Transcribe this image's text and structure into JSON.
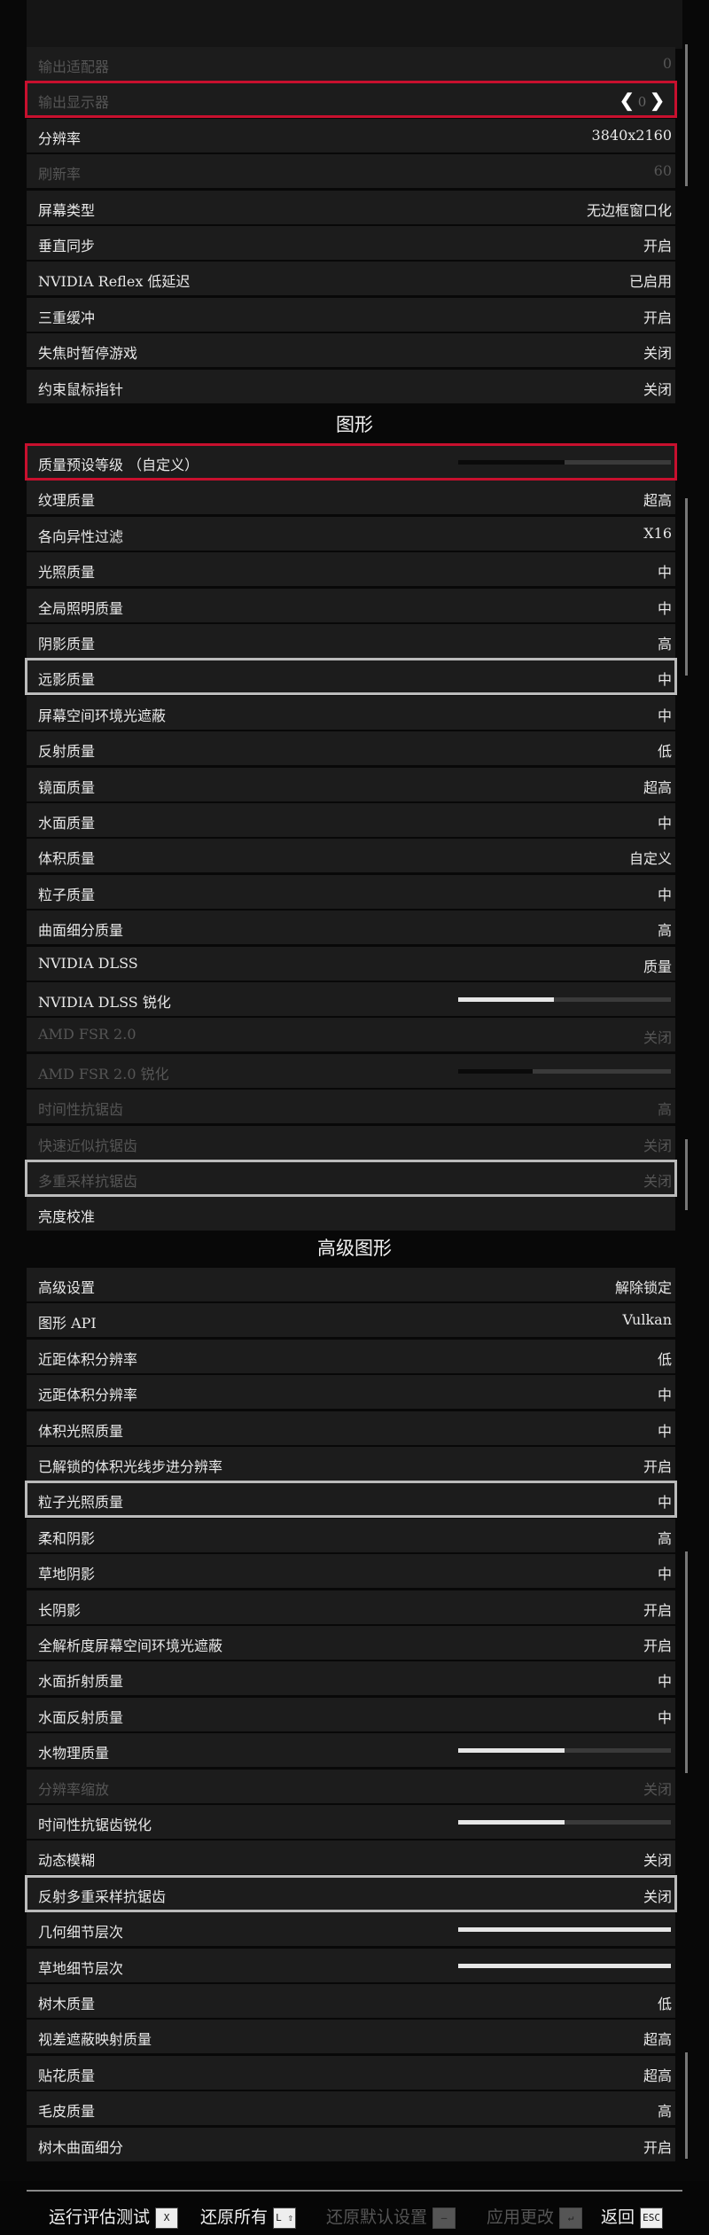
{
  "display_rows": [
    {
      "label": "输出适配器",
      "value": "0",
      "disabled": true
    },
    {
      "label": "输出显示器",
      "value": "0",
      "disabled": true,
      "arrows": true
    },
    {
      "label": "分辨率",
      "value": "3840x2160"
    },
    {
      "label": "刷新率",
      "value": "60",
      "disabled": true
    },
    {
      "label": "屏幕类型",
      "value": "无边框窗口化"
    },
    {
      "label": "垂直同步",
      "value": "开启"
    },
    {
      "label": "NVIDIA  Reflex  低延迟",
      "value": "已启用"
    },
    {
      "label": "三重缓冲",
      "value": "开启"
    },
    {
      "label": "失焦时暂停游戏",
      "value": "关闭"
    },
    {
      "label": "约束鼠标指针",
      "value": "关闭"
    }
  ],
  "graphics_title": "图形",
  "graphics_rows": [
    {
      "label": "质量预设等级  （自定义）",
      "value": "",
      "slider": 0.5,
      "slider_dark": true
    },
    {
      "label": "纹理质量",
      "value": "超高"
    },
    {
      "label": "各向异性过滤",
      "value": "X16"
    },
    {
      "label": "光照质量",
      "value": "中"
    },
    {
      "label": "全局照明质量",
      "value": "中"
    },
    {
      "label": "阴影质量",
      "value": "高"
    },
    {
      "label": "远影质量",
      "value": "中"
    },
    {
      "label": "屏幕空间环境光遮蔽",
      "value": "中"
    },
    {
      "label": "反射质量",
      "value": "低"
    },
    {
      "label": "镜面质量",
      "value": "超高"
    },
    {
      "label": "水面质量",
      "value": "中"
    },
    {
      "label": "体积质量",
      "value": "自定义"
    },
    {
      "label": "粒子质量",
      "value": "中"
    },
    {
      "label": "曲面细分质量",
      "value": "高"
    },
    {
      "label": "NVIDIA  DLSS",
      "value": "质量"
    },
    {
      "label": "NVIDIA DLSS 锐化",
      "value": "",
      "slider": 0.45
    },
    {
      "label": "AMD FSR 2.0",
      "value": "关闭",
      "disabled": true
    },
    {
      "label": "AMD FSR 2.0 锐化",
      "value": "",
      "slider": 0.35,
      "disabled": true
    },
    {
      "label": "时间性抗锯齿",
      "value": "高",
      "disabled": true
    },
    {
      "label": "快速近似抗锯齿",
      "value": "关闭",
      "disabled": true
    },
    {
      "label": "多重采样抗锯齿",
      "value": "关闭",
      "disabled": true
    },
    {
      "label": "亮度校准",
      "value": ""
    }
  ],
  "advanced_title": "高级图形",
  "advanced_rows": [
    {
      "label": "高级设置",
      "value": "解除锁定"
    },
    {
      "label": "图形 API",
      "value": "Vulkan"
    },
    {
      "label": "近距体积分辨率",
      "value": "低"
    },
    {
      "label": "远距体积分辨率",
      "value": "中"
    },
    {
      "label": "体积光照质量",
      "value": "中"
    },
    {
      "label": "已解锁的体积光线步进分辨率",
      "value": "开启"
    },
    {
      "label": "粒子光照质量",
      "value": "中"
    },
    {
      "label": "柔和阴影",
      "value": "高"
    },
    {
      "label": "草地阴影",
      "value": "中"
    },
    {
      "label": "长阴影",
      "value": "开启"
    },
    {
      "label": "全解析度屏幕空间环境光遮蔽",
      "value": "开启"
    },
    {
      "label": "水面折射质量",
      "value": "中"
    },
    {
      "label": "水面反射质量",
      "value": "中"
    },
    {
      "label": "水物理质量",
      "value": "",
      "slider": 0.5
    },
    {
      "label": "分辨率缩放",
      "value": "关闭",
      "disabled": true
    },
    {
      "label": "时间性抗锯齿锐化",
      "value": "",
      "slider": 0.5
    },
    {
      "label": "动态模糊",
      "value": "关闭"
    },
    {
      "label": "反射多重采样抗锯齿",
      "value": "关闭"
    },
    {
      "label": "几何细节层次",
      "value": "",
      "slider": 1.0
    },
    {
      "label": "草地细节层次",
      "value": "",
      "slider": 1.0
    },
    {
      "label": "树木质量",
      "value": "低"
    },
    {
      "label": "视差遮蔽映射质量",
      "value": "超高"
    },
    {
      "label": "贴花质量",
      "value": "超高"
    },
    {
      "label": "毛皮质量",
      "value": "高"
    },
    {
      "label": "树木曲面细分",
      "value": "开启"
    }
  ],
  "footer": {
    "benchmark": "运行评估测试",
    "benchmark_key": "X",
    "restore_all": "还原所有",
    "restore_all_key": "L ⇧",
    "restore_defaults": "还原默认设置",
    "restore_defaults_key": "—",
    "apply": "应用更改",
    "apply_key": "↵",
    "back": "返回",
    "back_key": "ESC"
  },
  "colors": {
    "accent_red": "#c8102e",
    "highlight": "#bbbbbb",
    "row_bg": "#1c1c1c"
  }
}
